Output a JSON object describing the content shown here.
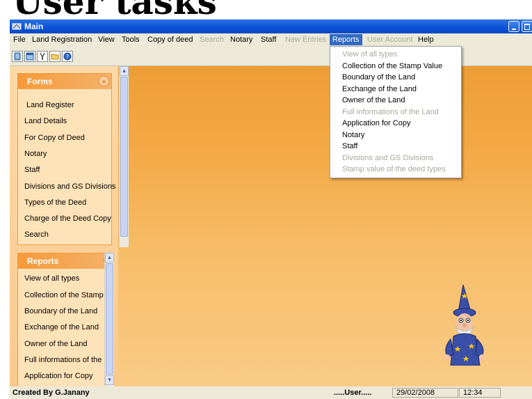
{
  "slide": {
    "title": "User tasks"
  },
  "window": {
    "title": "Main"
  },
  "menu": {
    "items": [
      {
        "label": "File",
        "state": "enabled"
      },
      {
        "label": "Land Registration",
        "state": "enabled"
      },
      {
        "label": "View",
        "state": "enabled"
      },
      {
        "label": "Tools",
        "state": "enabled"
      },
      {
        "label": "Copy of deed",
        "state": "enabled"
      },
      {
        "label": "Search",
        "state": "disabled"
      },
      {
        "label": "Notary",
        "state": "enabled"
      },
      {
        "label": "Staff",
        "state": "enabled"
      },
      {
        "label": "New Entries",
        "state": "disabled"
      },
      {
        "label": "Reports",
        "state": "active"
      },
      {
        "label": "User Account",
        "state": "disabled"
      },
      {
        "label": "Help",
        "state": "enabled"
      }
    ]
  },
  "reports_menu": {
    "items": [
      {
        "label": "View of all types",
        "enabled": false
      },
      {
        "label": "Collection of the Stamp Value",
        "enabled": true
      },
      {
        "label": "Boundary of the Land",
        "enabled": true
      },
      {
        "label": "Exchange of the Land",
        "enabled": true
      },
      {
        "label": "Owner of the Land",
        "enabled": true
      },
      {
        "label": "Full informations of the Land",
        "enabled": false
      },
      {
        "label": "Application for Copy",
        "enabled": true
      },
      {
        "label": "Notary",
        "enabled": true
      },
      {
        "label": "Staff",
        "enabled": true
      },
      {
        "label": "Divisions and GS Divisions",
        "enabled": false
      },
      {
        "label": "Stamp value of the deed types",
        "enabled": false
      }
    ]
  },
  "forms_panel": {
    "title": "Forms",
    "items": [
      "Land Register",
      "Land Details",
      "For Copy of Deed",
      "Notary",
      "Staff",
      "Divisions and GS Divisions",
      "Types of the Deed",
      "Charge of the Deed Copy",
      "Search"
    ]
  },
  "reports_panel": {
    "title": "Reports",
    "items": [
      "View of all types",
      "Collection of the Stamp V",
      "Boundary of the Land",
      "Exchange of the Land",
      "Owner of the Land",
      "Full informations of the L",
      "Application for Copy"
    ]
  },
  "status": {
    "created_by": "Created By G.Janany",
    "user": ".....User.....",
    "date": "29/02/2008",
    "time": "12:34"
  },
  "colors": {
    "titlebar": "#0a52d6",
    "workspace_top": "#ee9d36",
    "workspace_bottom": "#f9cb86",
    "panel_header": "#f79a3a",
    "menu_highlight": "#316ac5"
  }
}
